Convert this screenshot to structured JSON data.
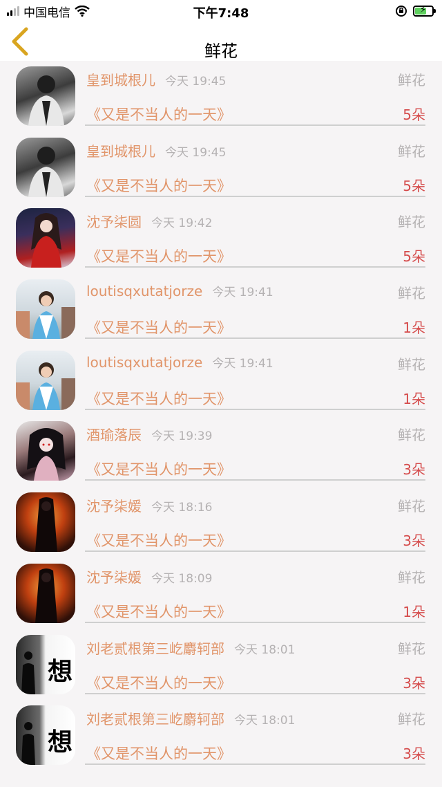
{
  "status_bar": {
    "carrier": "中国电信",
    "time": "下午7:48"
  },
  "nav": {
    "title": "鲜花"
  },
  "rows": [
    {
      "username": "皇到城根儿",
      "time": "今天 19:45",
      "category": "鲜花",
      "title": "《又是不当人的一天》",
      "count": "5朵"
    },
    {
      "username": "皇到城根儿",
      "time": "今天 19:45",
      "category": "鲜花",
      "title": "《又是不当人的一天》",
      "count": "5朵"
    },
    {
      "username": "沈予柒圆",
      "time": "今天 19:42",
      "category": "鲜花",
      "title": "《又是不当人的一天》",
      "count": "5朵"
    },
    {
      "username": "loutisqxutatjorze",
      "time": "今天 19:41",
      "category": "鲜花",
      "title": "《又是不当人的一天》",
      "count": "1朵"
    },
    {
      "username": "loutisqxutatjorze",
      "time": "今天 19:41",
      "category": "鲜花",
      "title": "《又是不当人的一天》",
      "count": "1朵"
    },
    {
      "username": "酒瑜落辰",
      "time": "今天 19:39",
      "category": "鲜花",
      "title": "《又是不当人的一天》",
      "count": "3朵"
    },
    {
      "username": "沈予柒媛",
      "time": "今天 18:16",
      "category": "鲜花",
      "title": "《又是不当人的一天》",
      "count": "3朵"
    },
    {
      "username": "沈予柒媛",
      "time": "今天 18:09",
      "category": "鲜花",
      "title": "《又是不当人的一天》",
      "count": "1朵"
    },
    {
      "username": "刘老贰根第三屹麝轲部",
      "time": "今天 18:01",
      "category": "鲜花",
      "title": "《又是不当人的一天》",
      "count": "3朵"
    },
    {
      "username": "刘老贰根第三屹麝轲部",
      "time": "今天 18:01",
      "category": "鲜花",
      "title": "《又是不当人的一天》",
      "count": "3朵"
    }
  ],
  "avatar_text": "想",
  "colors": {
    "username": "#e1956a",
    "count": "#d54b4b",
    "muted": "#b5b2b3",
    "back_arrow": "#d9a520"
  }
}
